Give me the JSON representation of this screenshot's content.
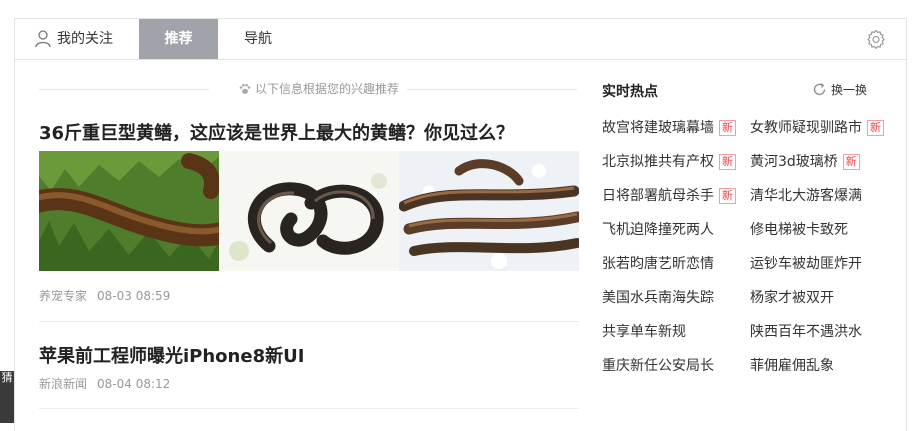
{
  "tabs": {
    "follow": "我的关注",
    "recommend": "推荐",
    "nav": "导航"
  },
  "feed": {
    "hint": "以下信息根据您的兴趣推荐",
    "articles": [
      {
        "title": "36斤重巨型黄鳝，这应该是世界上最大的黄鳝？你见过么？",
        "source": "养宠专家",
        "time": "08-03 08:59"
      },
      {
        "title": "苹果前工程师曝光iPhone8新UI",
        "source": "新浪新闻",
        "time": "08-04 08:12"
      }
    ]
  },
  "hot": {
    "title": "实时热点",
    "refresh": "换一换",
    "new_label": "新",
    "items": [
      {
        "text": "故宫将建玻璃幕墙",
        "is_new": true
      },
      {
        "text": "女教师疑现驯路市",
        "is_new": true
      },
      {
        "text": "北京拟推共有产权",
        "is_new": true
      },
      {
        "text": "黄河3d玻璃桥",
        "is_new": true
      },
      {
        "text": "日将部署航母杀手",
        "is_new": true
      },
      {
        "text": "清华北大游客爆满",
        "is_new": false
      },
      {
        "text": "飞机迫降撞死两人",
        "is_new": false
      },
      {
        "text": "修电梯被卡致死",
        "is_new": false
      },
      {
        "text": "张若昀唐艺昕恋情",
        "is_new": false
      },
      {
        "text": "运钞车被劫匪炸开",
        "is_new": false
      },
      {
        "text": "美国水兵南海失踪",
        "is_new": false
      },
      {
        "text": "杨家才被双开",
        "is_new": false
      },
      {
        "text": "共享单车新规",
        "is_new": false
      },
      {
        "text": "陕西百年不遇洪水",
        "is_new": false
      },
      {
        "text": "重庆新任公安局长",
        "is_new": false
      },
      {
        "text": "菲佣雇佣乱象",
        "is_new": false
      }
    ]
  },
  "side_tab": "猜"
}
